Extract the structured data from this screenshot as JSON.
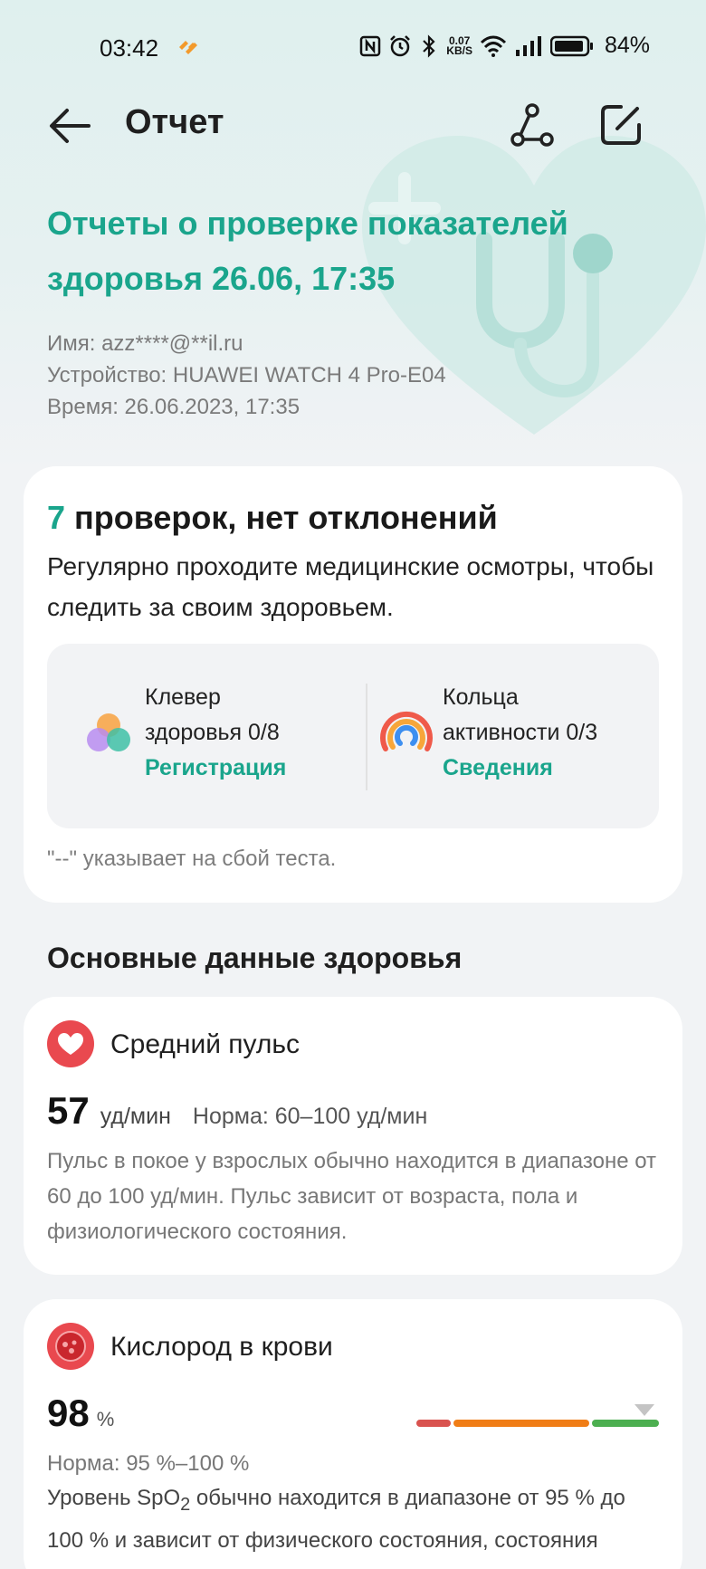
{
  "status_bar": {
    "time": "03:42",
    "net_speed_value": "0.07",
    "net_speed_unit": "KB/S",
    "battery": "84%"
  },
  "app_bar": {
    "title": "Отчет",
    "back_icon": "arrow-left-icon",
    "share_icon": "share-icon",
    "edit_icon": "edit-icon"
  },
  "report": {
    "title": "Отчеты о проверке показателей здоровья 26.06, 17:35",
    "name_line": "Имя: azz****@**il.ru",
    "device_line": "Устройство: HUAWEI WATCH 4 Pro-E04",
    "time_line": "Время: 26.06.2023, 17:35"
  },
  "summary": {
    "count": "7",
    "headline": " проверок, нет отклонений",
    "text": "Регулярно проходите медицинские осмотры, чтобы следить за своим здоровьем.",
    "clover_label_1": "Клевер",
    "clover_label_2": "здоровья 0/8",
    "clover_link": "Регистрация",
    "rings_label_1": "Кольца",
    "rings_label_2": "активности 0/3",
    "rings_link": "Сведения",
    "note": "\"--\" указывает на сбой теста."
  },
  "section": {
    "title": "Основные данные здоровья"
  },
  "pulse": {
    "title": "Средний пульс",
    "value": "57",
    "unit": "уд/мин",
    "norm": "Норма: 60–100 уд/мин",
    "description": "Пульс в покое у взрослых обычно находится в диапазоне от 60 до 100 уд/мин. Пульс зависит от возраста, пола и физиологического состояния."
  },
  "oxygen": {
    "title": "Кислород в крови",
    "value": "98",
    "unit": "%",
    "norm": "Норма: 95 %–100 %",
    "desc_prefix": "Уровень SpO",
    "desc_sub": "2",
    "desc_rest": " обычно находится в диапазоне от 95 % до 100 % и зависит от физического состояния, состояния здоровья и высоты."
  },
  "colors": {
    "accent": "#1aa58c",
    "scale_red": "#d9534f",
    "scale_orange": "#f07d16",
    "scale_green": "#4caf50"
  }
}
